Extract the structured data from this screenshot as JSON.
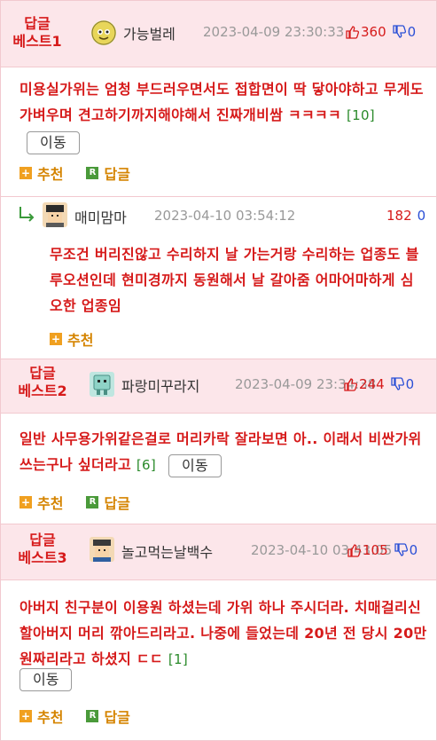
{
  "common": {
    "recommend_label": "추천",
    "reply_label": "답글",
    "move_label": "이동"
  },
  "comments": [
    {
      "badge_line1": "답글",
      "badge_line2": "베스트1",
      "nickname": "가능벌레",
      "date": "2023-04-09 23:30:33",
      "up": "360",
      "down": "0",
      "text": "미용실가위는 엄청 부드러우면서도 접합면이 딱 닿아야하고 무게도 가벼우며 견고하기까지해야해서 진짜개비쌈 ㅋㅋㅋㅋ",
      "count": "[10]"
    },
    {
      "nickname": "매미맘마",
      "date": "2023-04-10 03:54:12",
      "up": "182",
      "down": "0",
      "text": "무조건 버리진않고 수리하지 날 가는거랑 수리하는 업종도 블루오션인데 현미경까지 동원해서 날 갈아줌 어마어마하게 심오한 업종임"
    },
    {
      "badge_line1": "답글",
      "badge_line2": "베스트2",
      "nickname": "파랑미꾸라지",
      "date": "2023-04-09 23:34:38",
      "up": "244",
      "down": "0",
      "text": "일반 사무용가위같은걸로 머리카락 잘라보면 아.. 이래서 비싼가위 쓰는구나 싶더라고",
      "count": "[6]"
    },
    {
      "badge_line1": "답글",
      "badge_line2": "베스트3",
      "nickname": "놀고먹는날백수",
      "date": "2023-04-10 03:43:05",
      "up": "105",
      "down": "0",
      "text": "아버지 친구분이 이용원 하셨는데 가위 하나 주시더라. 치매걸리신 할아버지 머리 깎아드리라고. 나중에 들었는데 20년 전 당시 20만원짜리라고 하셨지 ㄷㄷ",
      "count": "[1]"
    }
  ]
}
